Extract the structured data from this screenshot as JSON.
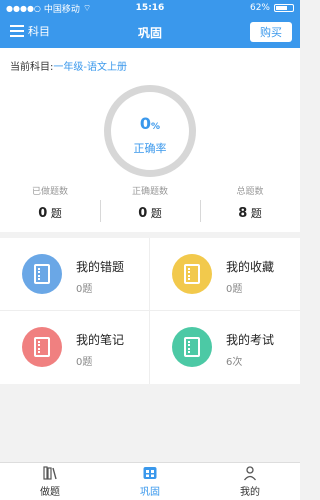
{
  "statusbar": {
    "carrier": "中国移动",
    "time": "15:16",
    "battery": "62%",
    "battery_level": 0.62
  },
  "navbar": {
    "left_label": "科目",
    "title": "巩固",
    "buy_label": "购买"
  },
  "summary": {
    "subject_prefix": "当前科目:",
    "subject_value": "一年级-语文上册",
    "accuracy_value": "0",
    "accuracy_unit": "%",
    "accuracy_label": "正确率",
    "stats": [
      {
        "title": "已做题数",
        "value": "0",
        "unit": "题"
      },
      {
        "title": "正确题数",
        "value": "0",
        "unit": "题"
      },
      {
        "title": "总题数",
        "value": "8",
        "unit": "题"
      }
    ]
  },
  "cards": [
    {
      "title": "我的错题",
      "count": "0题",
      "color": "#6aa7e6",
      "icon": "error-book-icon"
    },
    {
      "title": "我的收藏",
      "count": "0题",
      "color": "#f2c94c",
      "icon": "favorite-book-icon"
    },
    {
      "title": "我的笔记",
      "count": "0题",
      "color": "#f08080",
      "icon": "note-book-icon"
    },
    {
      "title": "我的考试",
      "count": "6次",
      "color": "#4cc9a5",
      "icon": "exam-icon"
    }
  ],
  "tabs": [
    {
      "label": "做题",
      "icon": "books-icon"
    },
    {
      "label": "巩固",
      "icon": "consolidate-icon",
      "active": true
    },
    {
      "label": "我的",
      "icon": "user-icon"
    }
  ],
  "colors": {
    "primary": "#3a98ec"
  }
}
